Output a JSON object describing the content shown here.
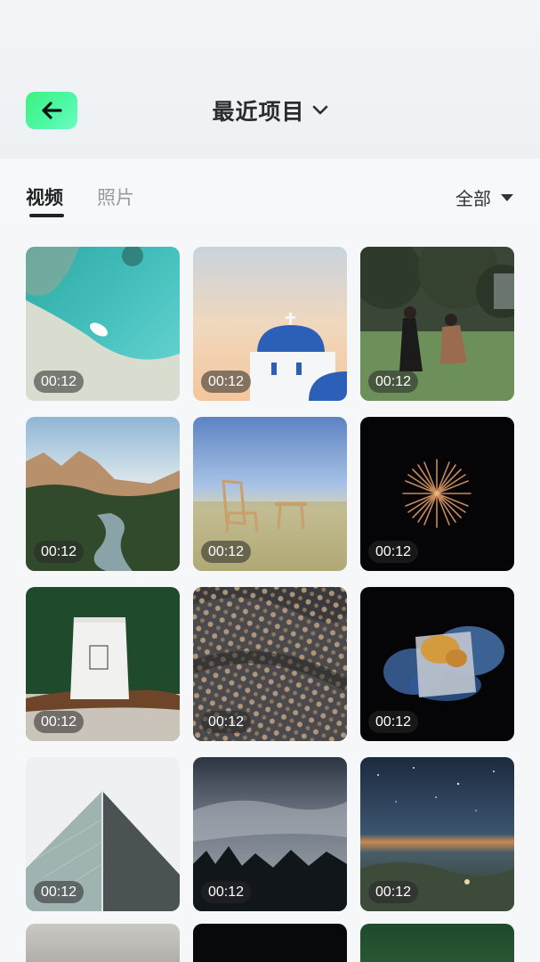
{
  "header": {
    "title": "最近项目",
    "back_icon": "arrow-left-icon",
    "title_chevron_icon": "chevron-down-icon",
    "accent_color": "#3df27f"
  },
  "tabs": {
    "items": [
      {
        "label": "视频",
        "active": true
      },
      {
        "label": "照片",
        "active": false
      }
    ]
  },
  "filter": {
    "label": "全部",
    "icon": "caret-down-icon"
  },
  "grid": {
    "items": [
      {
        "duration": "00:12",
        "subject": "aerial-beach-boat"
      },
      {
        "duration": "00:12",
        "subject": "blue-dome-church"
      },
      {
        "duration": "00:12",
        "subject": "couple-in-field"
      },
      {
        "duration": "00:12",
        "subject": "canyon-river"
      },
      {
        "duration": "00:12",
        "subject": "chair-in-meadow"
      },
      {
        "duration": "00:12",
        "subject": "firework-burst"
      },
      {
        "duration": "00:12",
        "subject": "coffee-bag"
      },
      {
        "duration": "00:12",
        "subject": "beaded-fabric"
      },
      {
        "duration": "00:12",
        "subject": "cube-with-smoke"
      },
      {
        "duration": "00:12",
        "subject": "skyscraper-corner"
      },
      {
        "duration": "00:12",
        "subject": "misty-forest"
      },
      {
        "duration": "00:12",
        "subject": "night-valley-stars"
      }
    ]
  }
}
